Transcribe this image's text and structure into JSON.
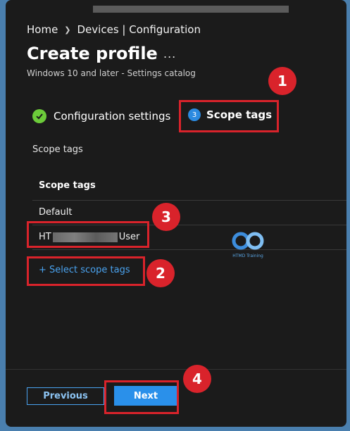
{
  "breadcrumb": {
    "home": "Home",
    "devices": "Devices | Configuration"
  },
  "page": {
    "title": "Create profile",
    "more": "...",
    "subtitle": "Windows 10 and later - Settings catalog"
  },
  "steps": {
    "config": {
      "label": "Configuration settings",
      "icon": "check-icon"
    },
    "scope": {
      "number": "3",
      "label": "Scope tags"
    }
  },
  "scope_section": {
    "label": "Scope tags",
    "table_header": "Scope tags",
    "rows": [
      {
        "prefix": "Default",
        "suffix": ""
      },
      {
        "prefix": "HT",
        "suffix": "User"
      }
    ],
    "select_link": "+ Select scope tags"
  },
  "watermark": {
    "text": "HTMD Training"
  },
  "footer": {
    "previous": "Previous",
    "next": "Next"
  },
  "annotations": {
    "badges": [
      "1",
      "2",
      "3",
      "4"
    ]
  },
  "colors": {
    "accent": "#2a90ea",
    "highlight": "#d9232b",
    "success": "#6ccb3a",
    "link": "#4aa3f0"
  }
}
